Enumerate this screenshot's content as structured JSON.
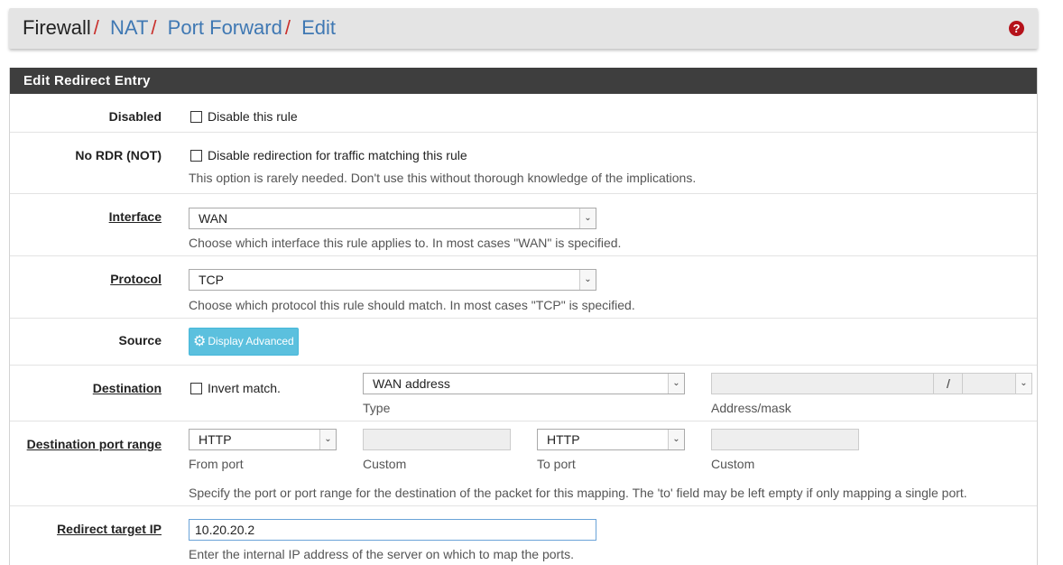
{
  "breadcrumb": {
    "root": "Firewall",
    "items": [
      "NAT",
      "Port Forward",
      "Edit"
    ],
    "separator": "/"
  },
  "help_icon": "?",
  "panel": {
    "title": "Edit Redirect Entry"
  },
  "disabled": {
    "label": "Disabled",
    "checkbox_label": "Disable this rule"
  },
  "nordr": {
    "label": "No RDR (NOT)",
    "checkbox_label": "Disable redirection for traffic matching this rule",
    "hint": "This option is rarely needed. Don't use this without thorough knowledge of the implications."
  },
  "interface": {
    "label": "Interface",
    "value": "WAN",
    "hint": "Choose which interface this rule applies to. In most cases \"WAN\" is specified."
  },
  "protocol": {
    "label": "Protocol",
    "value": "TCP",
    "hint": "Choose which protocol this rule should match. In most cases \"TCP\" is specified."
  },
  "source": {
    "label": "Source",
    "button_label": "Display Advanced"
  },
  "destination": {
    "label": "Destination",
    "invert_label": "Invert match.",
    "type_value": "WAN address",
    "type_hint": "Type",
    "address_hint": "Address/mask",
    "mask_separator": "/"
  },
  "dest_ports": {
    "label": "Destination port range",
    "from_value": "HTTP",
    "from_hint": "From port",
    "custom_hint_1": "Custom",
    "to_value": "HTTP",
    "to_hint": "To port",
    "custom_hint_2": "Custom",
    "hint": "Specify the port or port range for the destination of the packet for this mapping. The 'to' field may be left empty if only mapping a single port."
  },
  "redirect_ip": {
    "label": "Redirect target IP",
    "value": "10.20.20.2",
    "hint": "Enter the internal IP address of the server on which to map the ports."
  },
  "colors": {
    "header_bg": "#3e3e3e",
    "link": "#3f78b3",
    "separator": "#c9302c",
    "info_button": "#5bc0de",
    "help_icon": "#b5121b"
  }
}
